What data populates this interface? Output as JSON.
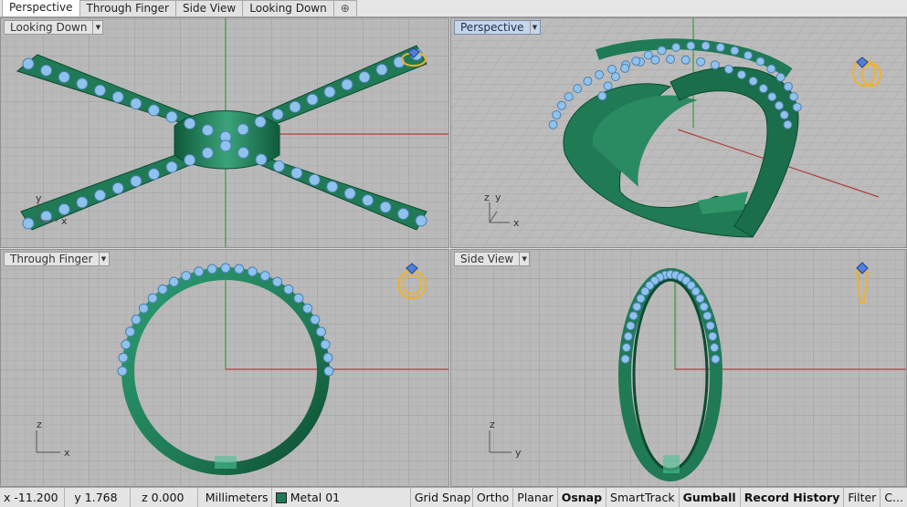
{
  "tabs": [
    {
      "label": "Perspective",
      "active": true
    },
    {
      "label": "Through Finger",
      "active": false
    },
    {
      "label": "Side View",
      "active": false
    },
    {
      "label": "Looking Down",
      "active": false
    }
  ],
  "add_tab_icon": "plus-icon",
  "viewports": {
    "top": {
      "label": "Looking Down",
      "axis_y": "y",
      "axis_x": "x"
    },
    "perspective": {
      "label": "Perspective",
      "axis_z": "z",
      "axis_y": "y",
      "axis_x": "x"
    },
    "front": {
      "label": "Through Finger",
      "axis_z": "z",
      "axis_x": "x"
    },
    "right": {
      "label": "Side View",
      "axis_z": "z",
      "axis_y": "y"
    }
  },
  "colors": {
    "metal": "#1f7a55",
    "gem": "#8fc2ec",
    "grid_bg": "#b9b9b9",
    "grid_line": "#a9a9a9",
    "grid_major": "#9a9a9a",
    "axis_x": "#b04040",
    "axis_y": "#3a9a3a",
    "active_label": "#c6d6ea"
  },
  "statusbar": {
    "x": "x -11.200",
    "y": "y 1.768",
    "z": "z 0.000",
    "units": "Millimeters",
    "layer": "Metal 01",
    "grid_snap": "Grid Snap",
    "ortho": "Ortho",
    "planar": "Planar",
    "osnap": "Osnap",
    "smarttrack": "SmartTrack",
    "gumball": "Gumball",
    "record_history": "Record History",
    "filter": "Filter",
    "more": "C..."
  }
}
